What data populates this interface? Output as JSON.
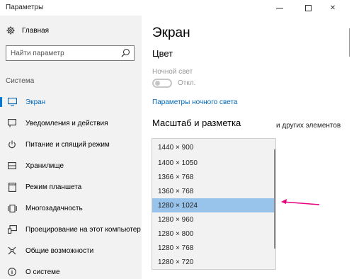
{
  "window": {
    "title": "Параметры",
    "controls": {
      "minimize": "—",
      "maximize": "",
      "close": "✕"
    }
  },
  "sidebar": {
    "home_label": "Главная",
    "search_placeholder": "Найти параметр",
    "section_label": "Система",
    "items": [
      {
        "label": "Экран",
        "icon": "monitor-icon",
        "active": true
      },
      {
        "label": "Уведомления и действия",
        "icon": "notification-icon"
      },
      {
        "label": "Питание и спящий режим",
        "icon": "power-icon"
      },
      {
        "label": "Хранилище",
        "icon": "storage-icon"
      },
      {
        "label": "Режим планшета",
        "icon": "tablet-icon"
      },
      {
        "label": "Многозадачность",
        "icon": "multitask-icon"
      },
      {
        "label": "Проецирование на этот компьютер",
        "icon": "projection-icon"
      },
      {
        "label": "Общие возможности",
        "icon": "shared-icon"
      },
      {
        "label": "О системе",
        "icon": "info-icon"
      }
    ]
  },
  "main": {
    "title": "Экран",
    "color_heading": "Цвет",
    "night_light_label": "Ночной свет",
    "toggle_state": "Откл.",
    "night_light_link": "Параметры ночного света",
    "scale_heading": "Масштаб и разметка",
    "clipped_text": "и других элементов"
  },
  "resolution_dropdown": {
    "options": [
      "1440 × 900",
      "1400 × 1050",
      "1366 × 768",
      "1360 × 768",
      "1280 × 1024",
      "1280 × 960",
      "1280 × 800",
      "1280 × 768",
      "1280 × 720"
    ],
    "selected": "1280 × 1024"
  },
  "colors": {
    "accent": "#0078d7",
    "link": "#0068b8",
    "selection": "#98c3ea",
    "annotation_arrow": "#e6007e"
  }
}
